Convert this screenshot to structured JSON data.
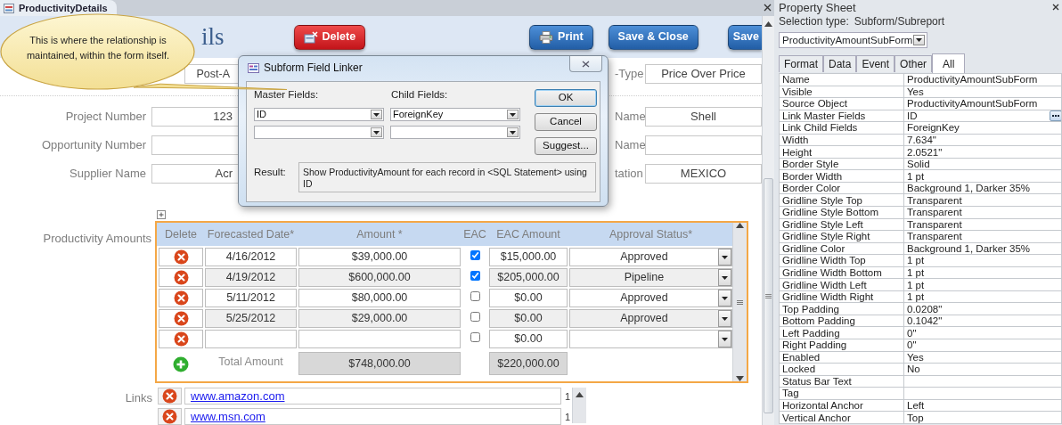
{
  "document_tab": {
    "title": "ProductivityDetails"
  },
  "form": {
    "title": "ils",
    "buttons": [
      {
        "label": "Delete",
        "kind": "delete"
      },
      {
        "label": "Print",
        "kind": "print"
      },
      {
        "label": "Save & Close",
        "kind": "save"
      },
      {
        "label": "Save",
        "kind": "save"
      }
    ],
    "rows": [
      {
        "left": {
          "value": "Post-A"
        },
        "right": {
          "label": "-Type",
          "value": "Price Over Price"
        }
      },
      {
        "left": {
          "label": "Project Number",
          "value": "123"
        },
        "right": {
          "label": "Name",
          "value": "Shell"
        }
      },
      {
        "left": {
          "label": "Opportunity Number"
        },
        "right": {
          "label": "Name"
        }
      },
      {
        "left": {
          "label": "Supplier Name",
          "value": "Acr"
        },
        "right": {
          "label": "tation",
          "value": "MEXICO"
        }
      }
    ]
  },
  "subform": {
    "label": "Productivity Amounts",
    "columns": [
      "Delete",
      "Forecasted Date*",
      "Amount *",
      "EAC",
      "EAC Amount",
      "Approval Status*"
    ],
    "rows": [
      {
        "date": "4/16/2012",
        "amount": "$39,000.00",
        "eac": true,
        "eac_amount": "$15,000.00",
        "status": "Approved"
      },
      {
        "date": "4/19/2012",
        "amount": "$600,000.00",
        "eac": true,
        "eac_amount": "$205,000.00",
        "status": "Pipeline"
      },
      {
        "date": "5/11/2012",
        "amount": "$80,000.00",
        "eac": false,
        "eac_amount": "$0.00",
        "status": "Approved"
      },
      {
        "date": "5/25/2012",
        "amount": "$29,000.00",
        "eac": false,
        "eac_amount": "$0.00",
        "status": "Approved"
      },
      {
        "eac": false,
        "eac_amount": "$0.00"
      }
    ],
    "total_label": "Total Amount",
    "total_amount": "$748,000.00",
    "total_eac_amount": "$220,000.00"
  },
  "links": {
    "label": "Links",
    "rows": [
      {
        "url": "www.amazon.com",
        "count": "1"
      },
      {
        "url": "www.msn.com",
        "count": "1"
      }
    ]
  },
  "dialog": {
    "title": "Subform Field Linker",
    "master_label": "Master Fields:",
    "child_label": "Child Fields:",
    "link_rows": [
      {
        "master": "ID",
        "child": "ForeignKey"
      },
      {}
    ],
    "buttons": [
      {
        "label": "OK",
        "default": true
      },
      {
        "label": "Cancel",
        "default": false
      },
      {
        "label": "Suggest...",
        "default": false
      }
    ],
    "result_label": "Result:",
    "result": "Show ProductivityAmount for each record in <SQL Statement> using ID"
  },
  "callout": {
    "text": "This is where the relationship is maintained, within the form itself."
  },
  "property_sheet": {
    "title": "Property Sheet",
    "selection_label": "Selection type:",
    "selection_type": "Subform/Subreport",
    "object": "ProductivityAmountSubForm",
    "tabs": [
      {
        "label": "Format",
        "selected": false
      },
      {
        "label": "Data",
        "selected": false
      },
      {
        "label": "Event",
        "selected": false
      },
      {
        "label": "Other",
        "selected": false
      },
      {
        "label": "All",
        "selected": true
      }
    ],
    "properties": [
      {
        "name": "Name",
        "value": "ProductivityAmountSubForm",
        "builder": false
      },
      {
        "name": "Visible",
        "value": "Yes",
        "builder": false
      },
      {
        "name": "Source Object",
        "value": "ProductivityAmountSubForm",
        "builder": false
      },
      {
        "name": "Link Master Fields",
        "value": "ID",
        "builder": true
      },
      {
        "name": "Link Child Fields",
        "value": "ForeignKey",
        "builder": false
      },
      {
        "name": "Width",
        "value": "7.634\"",
        "builder": false
      },
      {
        "name": "Height",
        "value": "2.0521\"",
        "builder": false
      },
      {
        "name": "Border Style",
        "value": "Solid",
        "builder": false
      },
      {
        "name": "Border Width",
        "value": "1 pt",
        "builder": false
      },
      {
        "name": "Border Color",
        "value": "Background 1, Darker 35%",
        "builder": false
      },
      {
        "name": "Gridline Style Top",
        "value": "Transparent",
        "builder": false
      },
      {
        "name": "Gridline Style Bottom",
        "value": "Transparent",
        "builder": false
      },
      {
        "name": "Gridline Style Left",
        "value": "Transparent",
        "builder": false
      },
      {
        "name": "Gridline Style Right",
        "value": "Transparent",
        "builder": false
      },
      {
        "name": "Gridline Color",
        "value": "Background 1, Darker 35%",
        "builder": false
      },
      {
        "name": "Gridline Width Top",
        "value": "1 pt",
        "builder": false
      },
      {
        "name": "Gridline Width Bottom",
        "value": "1 pt",
        "builder": false
      },
      {
        "name": "Gridline Width Left",
        "value": "1 pt",
        "builder": false
      },
      {
        "name": "Gridline Width Right",
        "value": "1 pt",
        "builder": false
      },
      {
        "name": "Top Padding",
        "value": "0.0208\"",
        "builder": false
      },
      {
        "name": "Bottom Padding",
        "value": "0.1042\"",
        "builder": false
      },
      {
        "name": "Left Padding",
        "value": "0\"",
        "builder": false
      },
      {
        "name": "Right Padding",
        "value": "0\"",
        "builder": false
      },
      {
        "name": "Enabled",
        "value": "Yes",
        "builder": false
      },
      {
        "name": "Locked",
        "value": "No",
        "builder": false
      },
      {
        "name": "Status Bar Text",
        "builder": false
      },
      {
        "name": "Tag",
        "builder": false
      },
      {
        "name": "Horizontal Anchor",
        "value": "Left",
        "builder": false
      },
      {
        "name": "Vertical Anchor",
        "value": "Top",
        "builder": false
      }
    ]
  }
}
